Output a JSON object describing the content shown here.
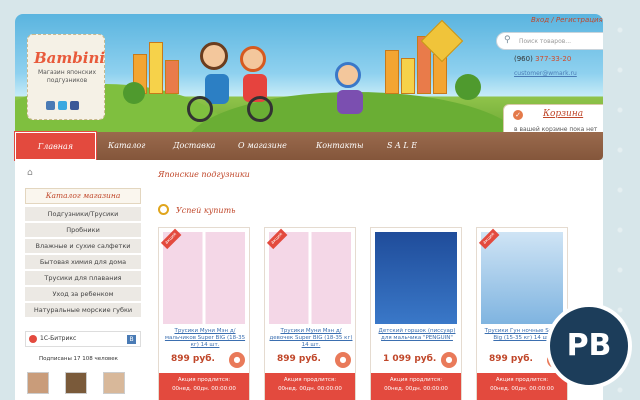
{
  "header": {
    "logo_title": "Bambini",
    "logo_subtitle": "Магазин японских подгузников",
    "top_links": "Вход / Регистрация",
    "search_placeholder": "Поиск товаров...",
    "phone_code": "(960)",
    "phone_number": "377-33-20",
    "email": "customer@wmark.ru",
    "cart_title": "Корзина",
    "cart_desc": "в вашей корзине пока нет товаров"
  },
  "nav": [
    {
      "label": "Главная"
    },
    {
      "label": "Каталог"
    },
    {
      "label": "Доставка"
    },
    {
      "label": "О магазине"
    },
    {
      "label": "Контакты"
    },
    {
      "label": "S A L E"
    }
  ],
  "sidebar": {
    "catalog_title": "Каталог магазина",
    "items": [
      {
        "label": "Подгузники/Трусики"
      },
      {
        "label": "Пробники"
      },
      {
        "label": "Влажные и сухие салфетки"
      },
      {
        "label": "Бытовая химия для дома"
      },
      {
        "label": "Трусики для плавания"
      },
      {
        "label": "Уход за ребенком"
      },
      {
        "label": "Натуральные морские губки"
      }
    ],
    "social_title": "1С-Битрикс",
    "social_vk": "В",
    "subscribers": "Подписаны 17 108 человек"
  },
  "main": {
    "page_title": "Японские подгузники",
    "section_title": "Успей купить"
  },
  "products": [
    {
      "badge": "акция",
      "name": "Трусики Муни Мэн д/ мальчиков Super BIG (18-35 кг) 14 шт.",
      "price": "899 руб.",
      "promo_line1": "Акция продлится:",
      "promo_line2": "00нед. 00дн. 00:00:00"
    },
    {
      "badge": "акция",
      "name": "Трусики Муни Мэн д/ девочек Super BIG (18-35 кг) 14 шт.",
      "price": "899 руб.",
      "promo_line1": "Акция продлится:",
      "promo_line2": "00нед. 00дн. 00:00:00"
    },
    {
      "badge": "",
      "name": "Детский горшок (писсуар) для мальчика \"PENGUIN\"",
      "price": "1 099 руб.",
      "promo_line1": "Акция продлится:",
      "promo_line2": "00нед. 00дн. 00:00:00"
    },
    {
      "badge": "акция",
      "name": "Трусики Гун ночные Super Big (15-35 кг) 14 шт.",
      "price": "899 руб.",
      "promo_line1": "Акция продлится:",
      "promo_line2": "00нед. 00дн. 00:00:00"
    }
  ],
  "watermark": "PB",
  "colors": {
    "accent": "#e34a3e",
    "nav": "#8b5c40",
    "link": "#3b6fb0"
  }
}
